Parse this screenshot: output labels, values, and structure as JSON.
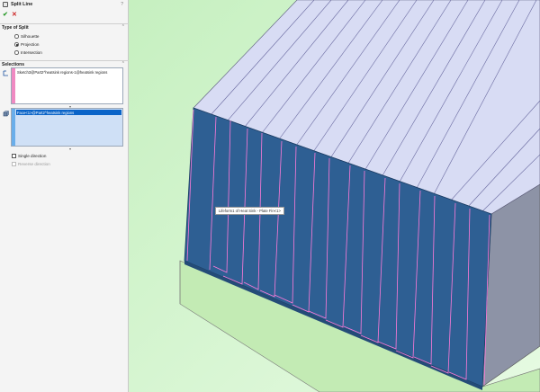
{
  "panel": {
    "title": "Split Line",
    "help": "?",
    "ok": "✔",
    "cancel": "✕"
  },
  "type_of_split": {
    "header": "Type of Split",
    "options": [
      {
        "label": "Silhouette",
        "selected": false
      },
      {
        "label": "Projection",
        "selected": true
      },
      {
        "label": "Intersection",
        "selected": false
      }
    ]
  },
  "selections": {
    "header": "Selections",
    "sketch_item": "Sketch3@Part2^heatsink regions-1@heatsink regions",
    "face_item": "Face<1>@Part2^heatsink regions"
  },
  "options": {
    "single_direction": "Single direction",
    "reverse_direction": "Reverse direction"
  },
  "viewport": {
    "tooltip": "Lifeform1 of Heat Sink - Plate Fin<1>"
  },
  "colors": {
    "background_green": "#d2f5cc",
    "top_face": "#d8dcf4",
    "front_face": "#2e5f93",
    "side_face": "#8d93a6",
    "split_line": "#ff7ad9",
    "selection_blue": "#0a64c8"
  }
}
